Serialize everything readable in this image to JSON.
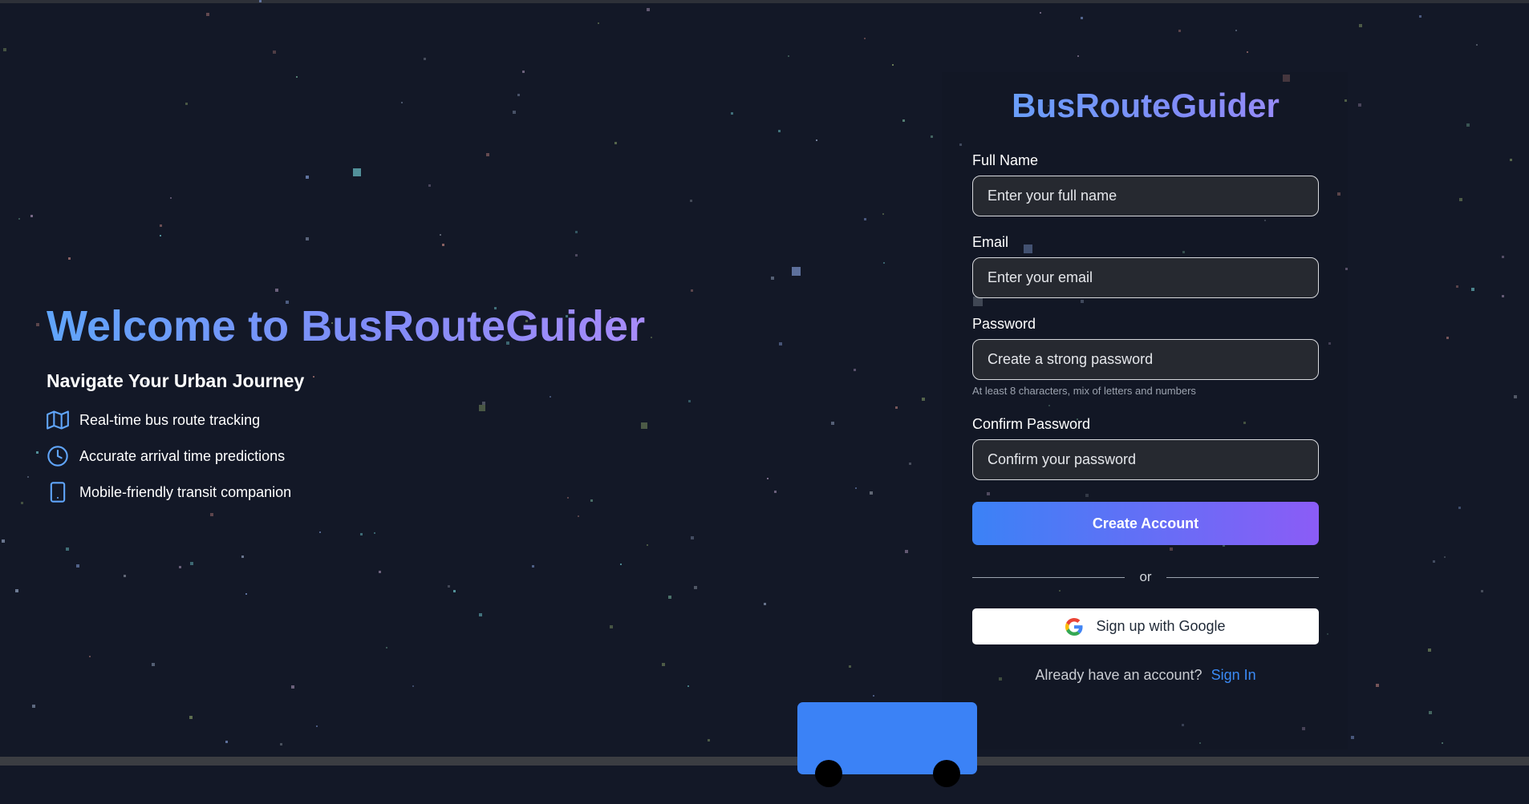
{
  "hero": {
    "title": "Welcome to BusRouteGuider",
    "subtitle": "Navigate Your Urban Journey",
    "features": [
      {
        "icon": "map-icon",
        "text": "Real-time bus route tracking"
      },
      {
        "icon": "clock-icon",
        "text": "Accurate arrival time predictions"
      },
      {
        "icon": "smartphone-icon",
        "text": "Mobile-friendly transit companion"
      }
    ]
  },
  "form": {
    "brand": "BusRouteGuider",
    "full_name": {
      "label": "Full Name",
      "placeholder": "Enter your full name",
      "value": ""
    },
    "email": {
      "label": "Email",
      "placeholder": "Enter your email",
      "value": ""
    },
    "password": {
      "label": "Password",
      "placeholder": "Create a strong password",
      "value": "",
      "hint": "At least 8 characters, mix of letters and numbers"
    },
    "confirm_password": {
      "label": "Confirm Password",
      "placeholder": "Confirm your password",
      "value": ""
    },
    "submit_label": "Create Account",
    "divider_text": "or",
    "google_label": "Sign up with Google",
    "signin_prompt": "Already have an account?",
    "signin_link": "Sign In"
  },
  "colors": {
    "background": "#131827",
    "accent_blue": "#3b82f6",
    "accent_purple": "#8b5cf6",
    "link": "#3b8bf6",
    "input_bg": "#262930"
  }
}
